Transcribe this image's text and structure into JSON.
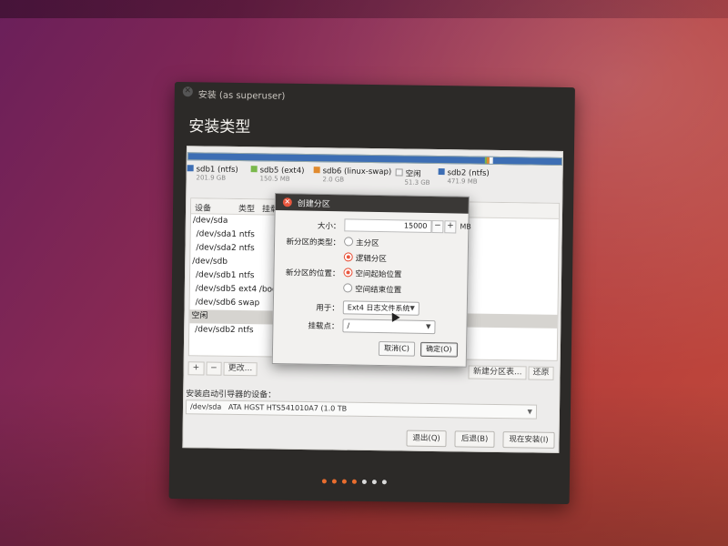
{
  "window": {
    "title": "安装 (as superuser)",
    "heading": "安装类型"
  },
  "partition_legend": [
    {
      "name": "sdb1 (ntfs)",
      "size": "201.9 GB",
      "color": "#3d6eb4"
    },
    {
      "name": "sdb5 (ext4)",
      "size": "150.5 MB",
      "color": "#7ab84c"
    },
    {
      "name": "sdb6 (linux-swap)",
      "size": "2.0 GB",
      "color": "#e08a2e"
    },
    {
      "name": "空闲",
      "size": "51.3 GB",
      "color": "#f4f4f4"
    },
    {
      "name": "sdb2 (ntfs)",
      "size": "471.9 MB",
      "color": "#3d6eb4"
    }
  ],
  "table": {
    "headers": [
      "设备",
      "类型",
      "挂载"
    ],
    "rows": [
      {
        "device": "/dev/sda",
        "mount": ""
      },
      {
        "device": "/dev/sda1 ntfs",
        "mount": ""
      },
      {
        "device": "/dev/sda2 ntfs",
        "mount": ""
      },
      {
        "device": "/dev/sdb",
        "mount": ""
      },
      {
        "device": "/dev/sdb1 ntfs",
        "mount": ""
      },
      {
        "device": "/dev/sdb5 ext4",
        "mount": "/boot"
      },
      {
        "device": "/dev/sdb6 swap",
        "mount": ""
      },
      {
        "device": "空闲",
        "mount": ""
      },
      {
        "device": "/dev/sdb2 ntfs",
        "mount": ""
      }
    ]
  },
  "table_tools": {
    "add": "+",
    "remove": "−",
    "change": "更改...",
    "new_table": "新建分区表...",
    "revert": "还原"
  },
  "boot_loader": {
    "label": "安装启动引导器的设备：",
    "device": "/dev/sda",
    "description": "ATA HGST HTS541010A7 (1.0 TB"
  },
  "buttons": {
    "quit": "退出(Q)",
    "back": "后退(B)",
    "install_now": "现在安装(I)"
  },
  "progress_dots": {
    "total": 7,
    "filled": 4,
    "active_color": "#e96d2e",
    "inactive_color": "#d9d9d9"
  },
  "dialog": {
    "title": "创建分区",
    "size_label": "大小：",
    "size_value": "15000",
    "size_minus": "−",
    "size_plus": "+",
    "size_unit": "MB",
    "type_label": "新分区的类型：",
    "type_primary": "主分区",
    "type_logical": "逻辑分区",
    "type_selected": "logical",
    "location_label": "新分区的位置：",
    "location_start": "空间起始位置",
    "location_end": "空间结束位置",
    "location_selected": "start",
    "use_as_label": "用于：",
    "use_as_value": "Ext4 日志文件系统",
    "mount_label": "挂载点：",
    "mount_value": "/",
    "cancel": "取消(C)",
    "ok": "确定(O)"
  }
}
